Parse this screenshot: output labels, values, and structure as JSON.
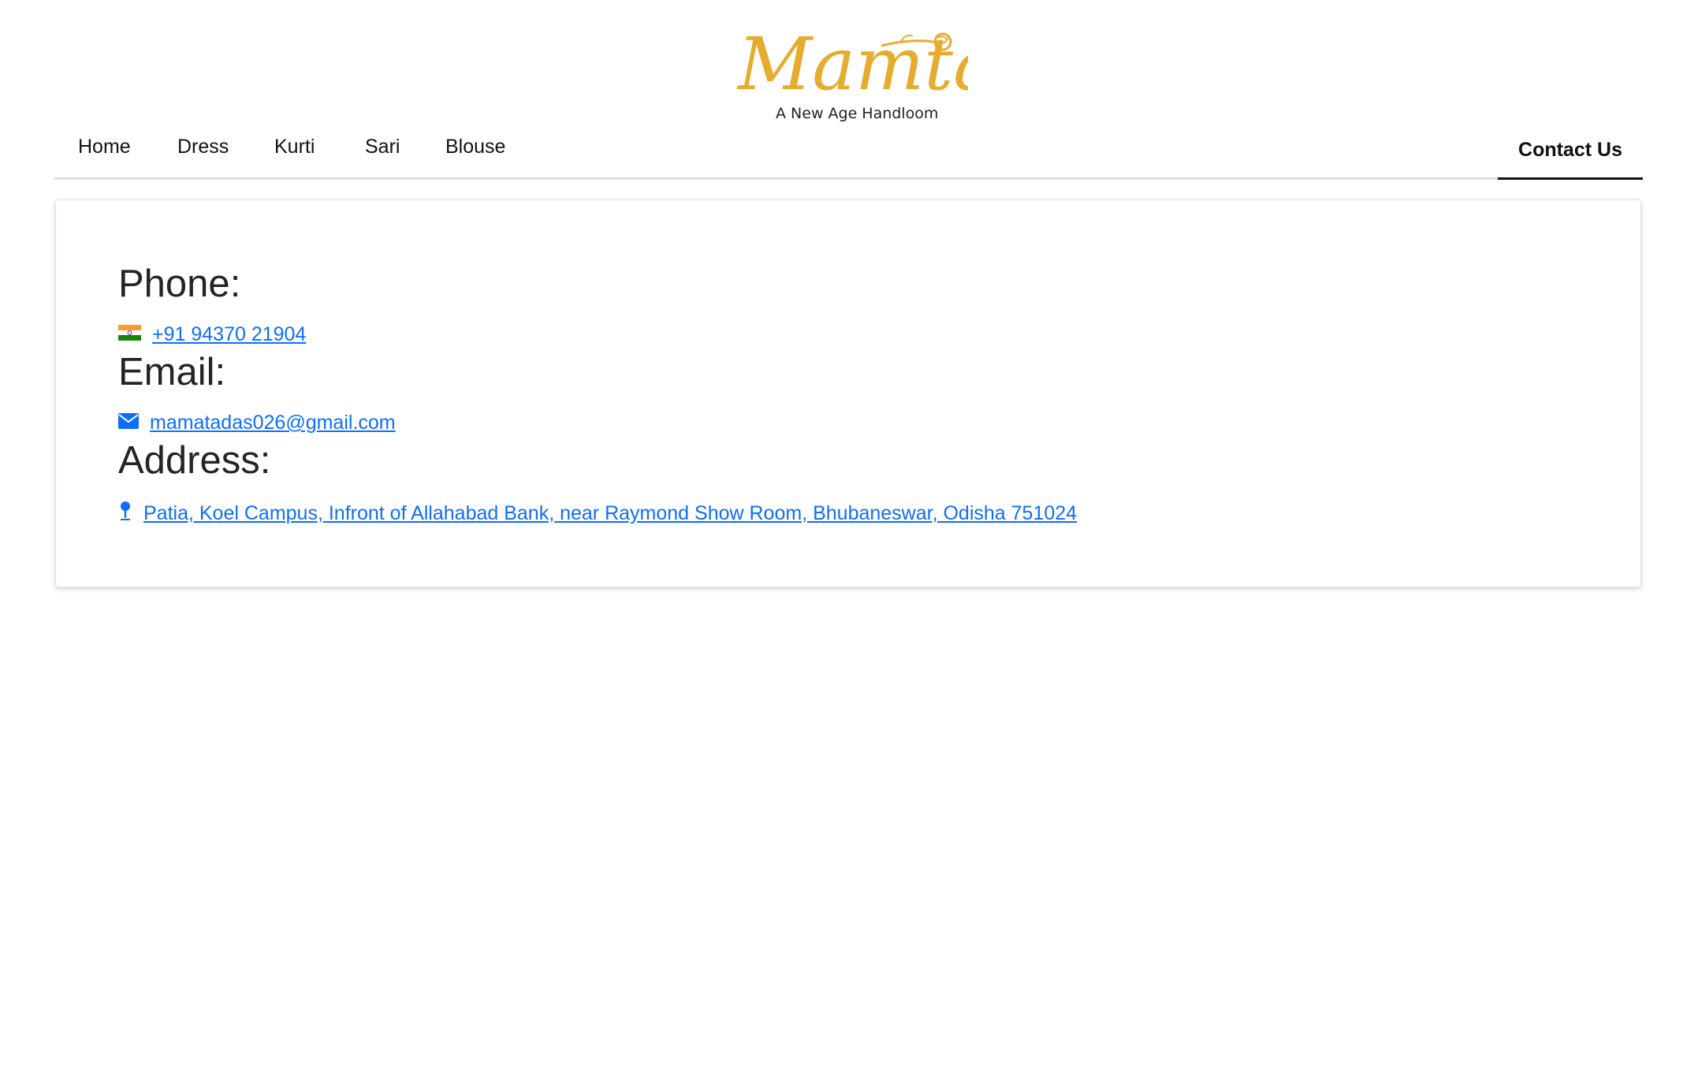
{
  "brand": {
    "logo_name": "Mamta",
    "tagline": "A New Age Handloom",
    "logo_color": "#E5AC2E"
  },
  "nav": {
    "items": [
      {
        "label": "Home"
      },
      {
        "label": "Dress"
      },
      {
        "label": "Kurti"
      },
      {
        "label": "Sari"
      },
      {
        "label": "Blouse"
      }
    ],
    "contact": {
      "label": "Contact Us",
      "active": true
    }
  },
  "contact": {
    "phone": {
      "heading": "Phone:",
      "icon": "india-flag-icon",
      "value": "+91 94370 21904"
    },
    "email": {
      "heading": "Email:",
      "icon": "envelope-icon",
      "value": "mamatadas026@gmail.com"
    },
    "address": {
      "heading": "Address:",
      "icon": "map-pin-icon",
      "value": "Patia, Koel Campus, Infront of Allahabad Bank, near Raymond Show Room, Bhubaneswar, Odisha 751024"
    }
  },
  "colors": {
    "link": "#0d6efd",
    "text": "#212529",
    "nav_border": "#dedede"
  }
}
